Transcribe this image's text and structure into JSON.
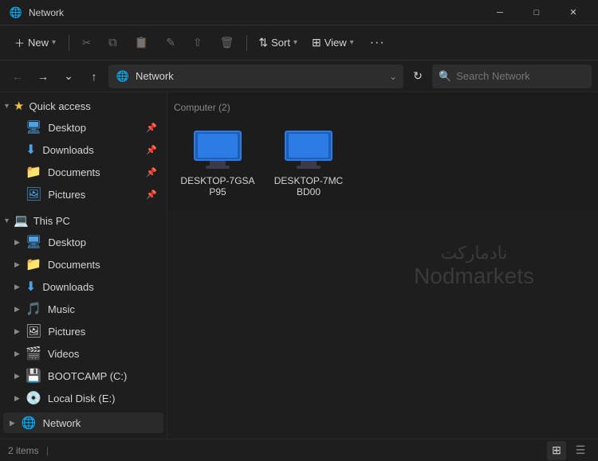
{
  "titlebar": {
    "icon": "🌐",
    "title": "Network",
    "minimize": "─",
    "maximize": "□",
    "close": "✕"
  },
  "toolbar": {
    "new_label": "New",
    "cut_icon": "✂",
    "copy_icon": "⧉",
    "paste_icon": "📋",
    "rename_icon": "✎",
    "share_icon": "⇧",
    "delete_icon": "🗑",
    "sort_label": "Sort",
    "view_label": "View",
    "more_icon": "···"
  },
  "addressbar": {
    "back_icon": "←",
    "forward_icon": "→",
    "expand_icon": "⌄",
    "up_icon": "↑",
    "location_icon": "🌐",
    "path": "Network",
    "refresh_icon": "↻",
    "search_placeholder": "Search Network"
  },
  "sidebar": {
    "quick_access_label": "Quick access",
    "quick_items": [
      {
        "label": "Desktop",
        "icon": "🖥",
        "pinned": true
      },
      {
        "label": "Downloads",
        "icon": "⬇",
        "pinned": true
      },
      {
        "label": "Documents",
        "icon": "📁",
        "pinned": true
      },
      {
        "label": "Pictures",
        "icon": "🖼",
        "pinned": true
      }
    ],
    "thispc_label": "This PC",
    "pc_items": [
      {
        "label": "Desktop",
        "icon": "🖥"
      },
      {
        "label": "Documents",
        "icon": "📁"
      },
      {
        "label": "Downloads",
        "icon": "⬇"
      },
      {
        "label": "Music",
        "icon": "🎵"
      },
      {
        "label": "Pictures",
        "icon": "🖼"
      },
      {
        "label": "Videos",
        "icon": "🎬"
      },
      {
        "label": "BOOTCAMP (C:)",
        "icon": "💾"
      },
      {
        "label": "Local Disk (E:)",
        "icon": "💿"
      }
    ],
    "network_label": "Network"
  },
  "content": {
    "section_label": "Computer (2)",
    "computers": [
      {
        "name": "DESKTOP-7GSAP95"
      },
      {
        "name": "DESKTOP-7MCBD00"
      }
    ],
    "watermark_arabic": "نادمارکت",
    "watermark_latin": "Nodmarkets"
  },
  "statusbar": {
    "count_label": "2 items",
    "sep": "|"
  }
}
